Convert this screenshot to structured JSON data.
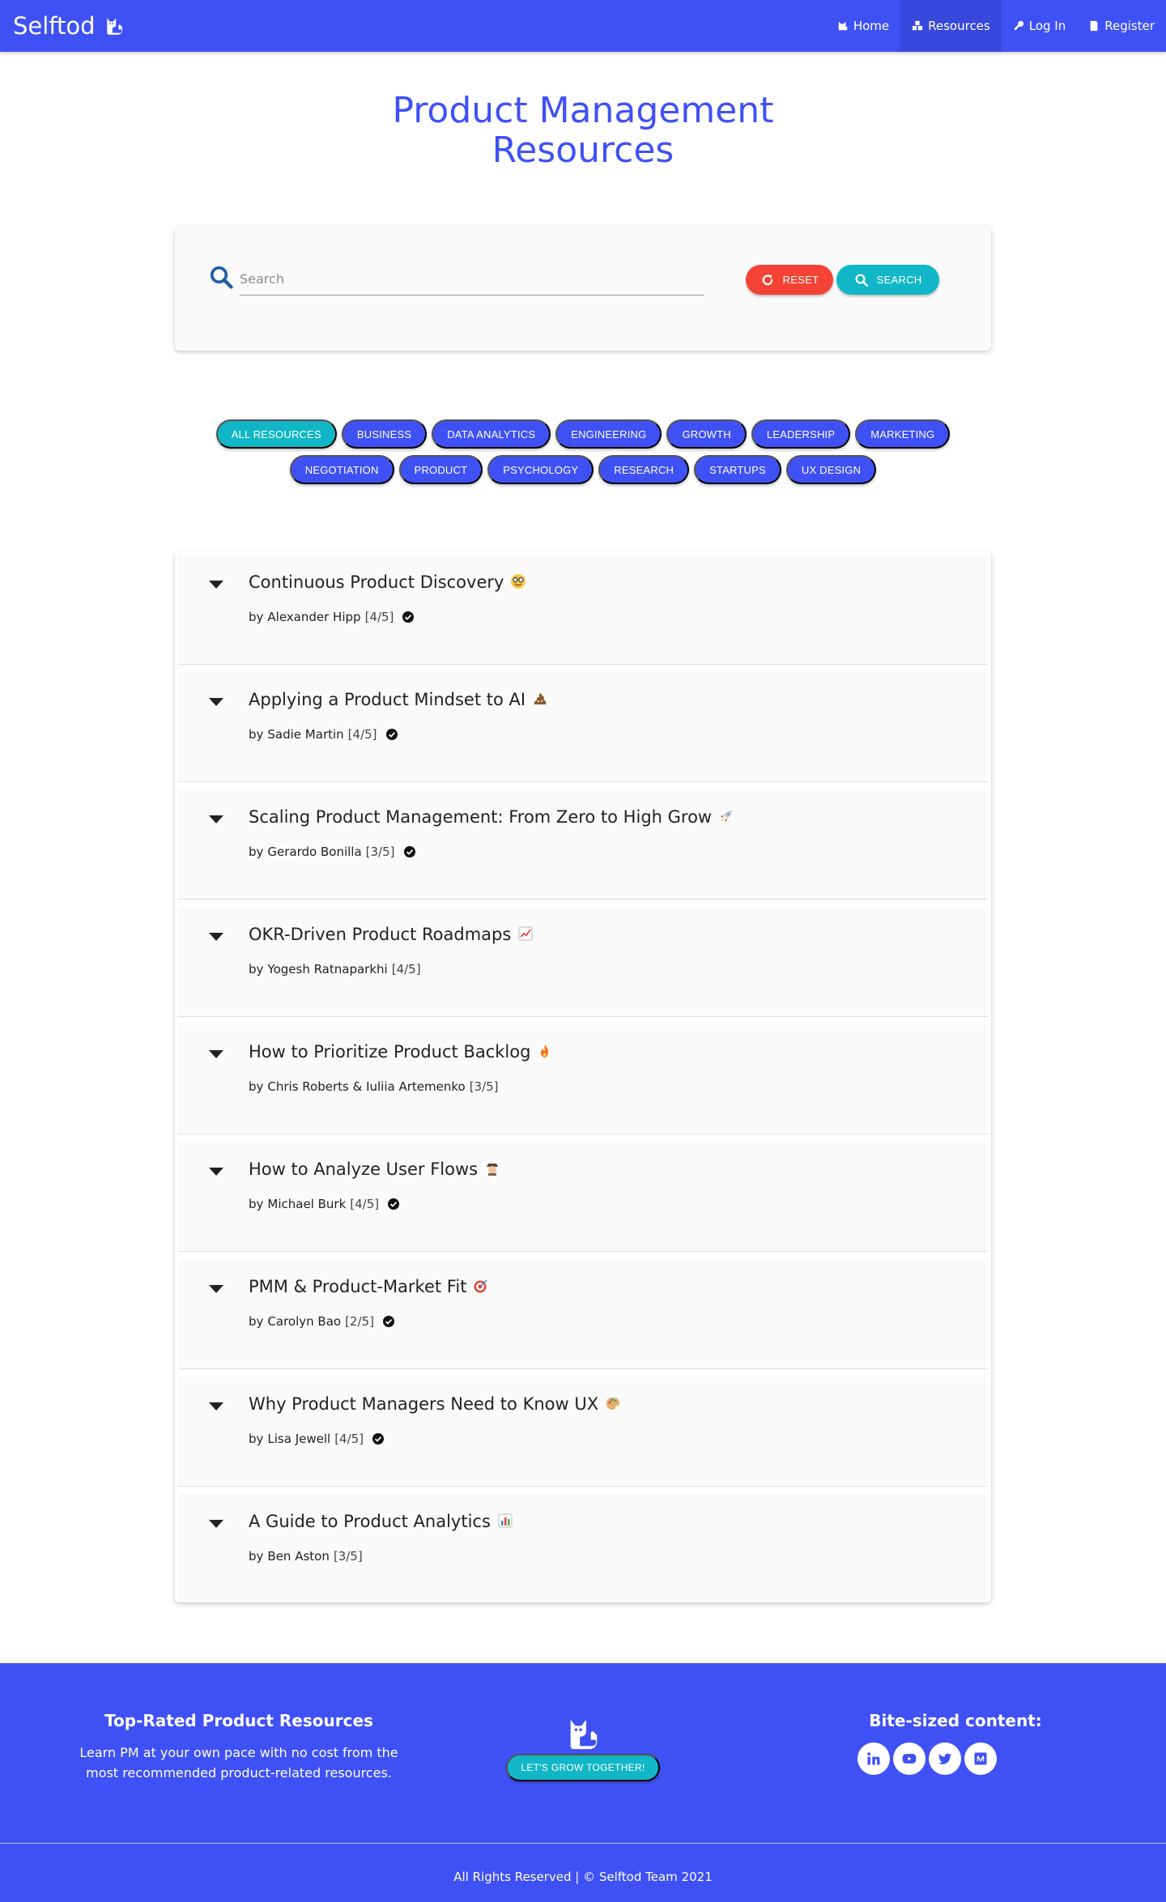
{
  "nav": {
    "brand": "Selftod",
    "links": [
      {
        "label": "Home",
        "icon": "home-icon",
        "active": false
      },
      {
        "label": "Resources",
        "icon": "boxes-icon",
        "active": true
      },
      {
        "label": "Log In",
        "icon": "key-icon",
        "active": false
      },
      {
        "label": "Register",
        "icon": "register-icon",
        "active": false
      }
    ]
  },
  "page": {
    "title_line1": "Product Management",
    "title_line2": "Resources"
  },
  "search": {
    "placeholder": "Search",
    "value": "",
    "reset_label": "RESET",
    "search_label": "SEARCH"
  },
  "categories": [
    {
      "label": "ALL RESOURCES",
      "active": true
    },
    {
      "label": "BUSINESS",
      "active": false
    },
    {
      "label": "DATA ANALYTICS",
      "active": false
    },
    {
      "label": "ENGINEERING",
      "active": false
    },
    {
      "label": "GROWTH",
      "active": false
    },
    {
      "label": "LEADERSHIP",
      "active": false
    },
    {
      "label": "MARKETING",
      "active": false
    },
    {
      "label": "NEGOTIATION",
      "active": false
    },
    {
      "label": "PRODUCT",
      "active": false
    },
    {
      "label": "PSYCHOLOGY",
      "active": false
    },
    {
      "label": "RESEARCH",
      "active": false
    },
    {
      "label": "STARTUPS",
      "active": false
    },
    {
      "label": "UX DESIGN",
      "active": false
    }
  ],
  "resources": [
    {
      "title": "Continuous Product Discovery",
      "emoji": "nerd-face-emoji",
      "by": "by",
      "author": "Alexander Hipp",
      "rating": "[4/5]",
      "verified": true
    },
    {
      "title": "Applying a Product Mindset to AI",
      "emoji": "pile-of-poo-emoji",
      "by": "by",
      "author": "Sadie Martin",
      "rating": "[4/5]",
      "verified": true
    },
    {
      "title": "Scaling Product Management: From Zero to High Grow",
      "emoji": "rocket-emoji",
      "by": "by",
      "author": "Gerardo Bonilla",
      "rating": "[3/5]",
      "verified": true
    },
    {
      "title": "OKR-Driven Product Roadmaps",
      "emoji": "chart-increasing-emoji",
      "by": "by",
      "author": "Yogesh Ratnaparkhi",
      "rating": "[4/5]",
      "verified": false
    },
    {
      "title": "How to Prioritize Product Backlog",
      "emoji": "fire-emoji",
      "by": "by",
      "author": "Chris Roberts & Iuliia Artemenko",
      "rating": "[3/5]",
      "verified": false
    },
    {
      "title": "How to Analyze User Flows",
      "emoji": "detective-emoji",
      "by": "by",
      "author": "Michael Burk",
      "rating": "[4/5]",
      "verified": true
    },
    {
      "title": "PMM & Product-Market Fit",
      "emoji": "direct-hit-emoji",
      "by": "by",
      "author": "Carolyn Bao",
      "rating": "[2/5]",
      "verified": true
    },
    {
      "title": "Why Product Managers Need to Know UX",
      "emoji": "artist-palette-emoji",
      "by": "by",
      "author": "Lisa Jewell",
      "rating": "[4/5]",
      "verified": true
    },
    {
      "title": "A Guide to Product Analytics",
      "emoji": "bar-chart-emoji",
      "by": "by",
      "author": "Ben Aston",
      "rating": "[3/5]",
      "verified": false
    }
  ],
  "footer": {
    "left_title": "Top-Rated Product Resources",
    "left_text": "Learn PM at your own pace with no cost from the most recommended product-related resources.",
    "cta_label": "LET'S GROW TOGETHER!",
    "right_title": "Bite-sized content:",
    "socials": [
      "linkedin-icon",
      "youtube-icon",
      "twitter-icon",
      "medium-icon"
    ],
    "copyright": "All Rights Reserved | © Selftod Team 2021"
  },
  "colors": {
    "primary": "#3f51f5",
    "accent": "#11b7c6",
    "danger": "#f44336"
  }
}
